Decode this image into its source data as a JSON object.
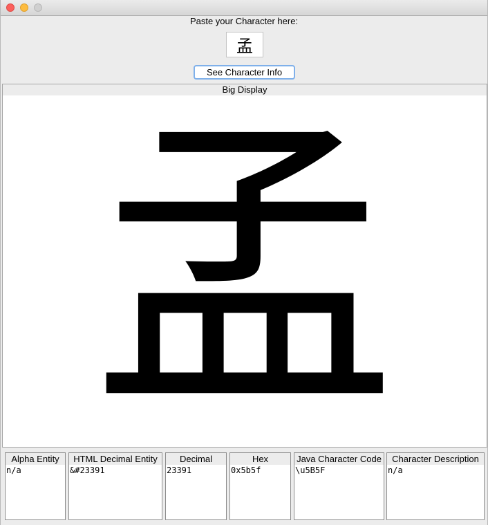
{
  "prompt_label": "Paste your Character here:",
  "character_input": "孟",
  "info_button_label": "See Character Info",
  "big_display": {
    "header": "Big Display",
    "character": "孟"
  },
  "info_fields": [
    {
      "label": "Alpha Entity",
      "value": "n/a"
    },
    {
      "label": "HTML Decimal Entity",
      "value": "&#23391"
    },
    {
      "label": "Decimal",
      "value": "23391"
    },
    {
      "label": "Hex",
      "value": "0x5b5f"
    },
    {
      "label": "Java Character Code",
      "value": "\\u5B5F"
    },
    {
      "label": "Character Description",
      "value": "n/a"
    }
  ]
}
